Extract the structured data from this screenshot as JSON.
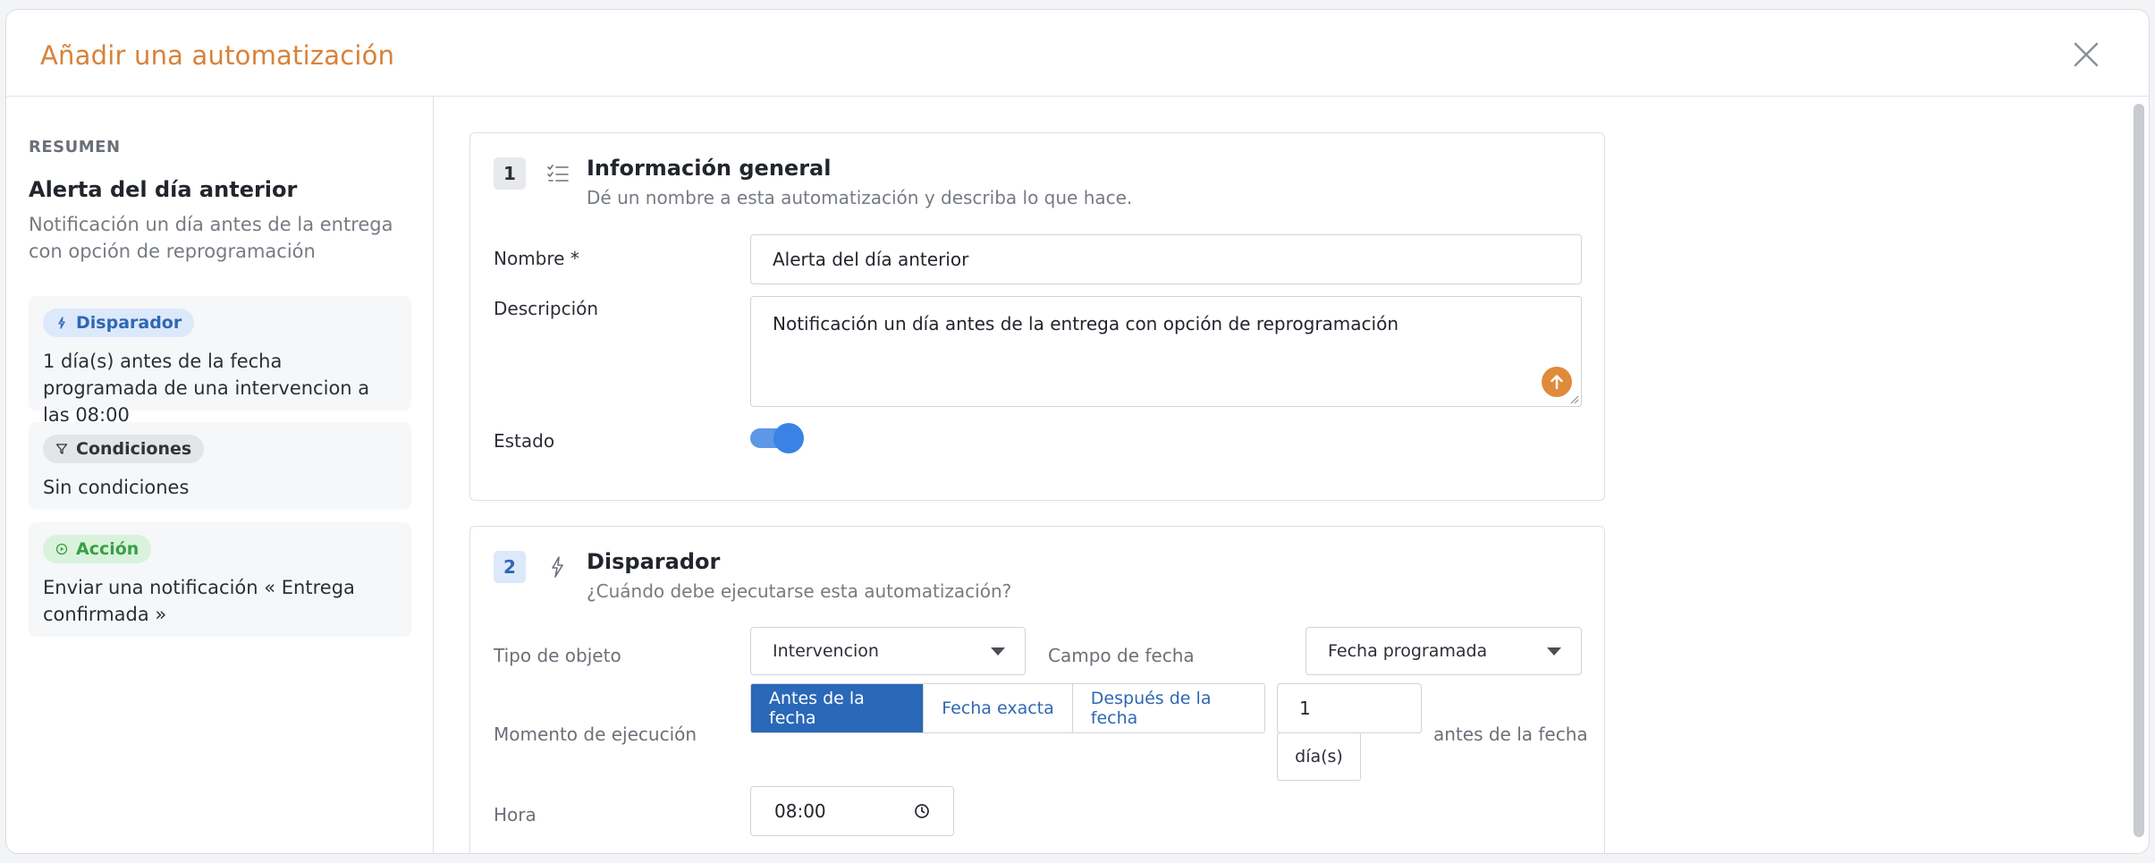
{
  "dialog": {
    "title": "Añadir una automatización"
  },
  "summary": {
    "heading": "RESUMEN",
    "name": "Alerta del día anterior",
    "description": "Notificación un día antes de la entrega con opción de reprogramación",
    "trigger": {
      "badge": "Disparador",
      "text": "1 día(s) antes de la fecha programada de una intervencion a las 08:00"
    },
    "conditions": {
      "badge": "Condiciones",
      "text": "Sin condiciones"
    },
    "action": {
      "badge": "Acción",
      "text": "Enviar una notificación « Entrega confirmada »"
    }
  },
  "general": {
    "step": "1",
    "title": "Información general",
    "subtitle": "Dé un nombre a esta automatización y describa lo que hace.",
    "name_label": "Nombre *",
    "name_value": "Alerta del día anterior",
    "description_label": "Descripción",
    "description_value": "Notificación un día antes de la entrega con opción de reprogramación",
    "status_label": "Estado",
    "status_on": true
  },
  "trigger": {
    "step": "2",
    "title": "Disparador",
    "subtitle": "¿Cuándo debe ejecutarse esta automatización?",
    "object_type_label": "Tipo de objeto",
    "object_type_value": "Intervencion",
    "date_field_label": "Campo de fecha",
    "date_field_value": "Fecha programada",
    "timing_label": "Momento de ejecución",
    "timing_options": [
      "Antes de la fecha",
      "Fecha exacta",
      "Después de la fecha"
    ],
    "timing_selected": "Antes de la fecha",
    "offset_value": "1",
    "offset_unit": "día(s)",
    "offset_suffix": "antes de la fecha",
    "time_label": "Hora",
    "time_value": "08:00"
  },
  "colors": {
    "accent_orange": "#d8823a",
    "primary_blue": "#2a68b8",
    "toggle_blue": "#3a82e6"
  }
}
